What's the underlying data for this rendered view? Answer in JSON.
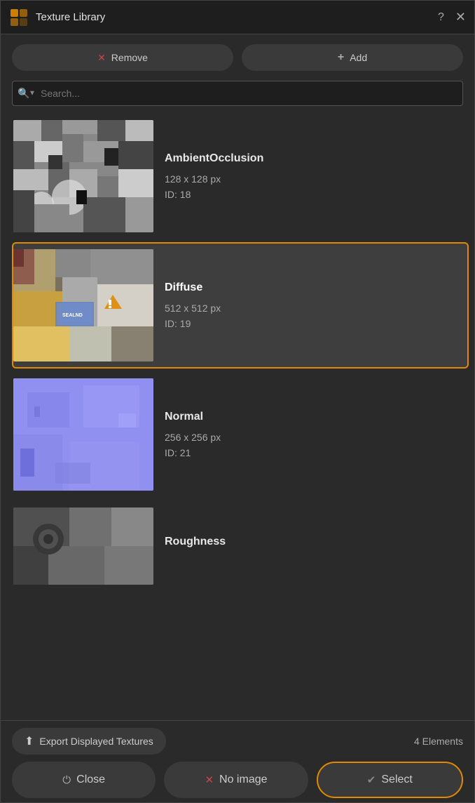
{
  "window": {
    "title": "Texture Library",
    "help_label": "?",
    "close_label": "✕"
  },
  "toolbar": {
    "remove_label": "Remove",
    "add_label": "Add"
  },
  "search": {
    "placeholder": "Search..."
  },
  "textures": [
    {
      "id": "ambient",
      "name": "AmbientOcclusion",
      "dimensions": "128 x 128 px",
      "texture_id": "ID: 18",
      "selected": false,
      "thumb_type": "ambient"
    },
    {
      "id": "diffuse",
      "name": "Diffuse",
      "dimensions": "512 x 512 px",
      "texture_id": "ID: 19",
      "selected": true,
      "thumb_type": "diffuse"
    },
    {
      "id": "normal",
      "name": "Normal",
      "dimensions": "256 x 256 px",
      "texture_id": "ID: 21",
      "selected": false,
      "thumb_type": "normal"
    },
    {
      "id": "roughness",
      "name": "Roughness",
      "dimensions": "",
      "texture_id": "",
      "selected": false,
      "thumb_type": "roughness"
    }
  ],
  "bottom": {
    "export_label": "Export Displayed Textures",
    "elements_count": "4 Elements",
    "close_label": "Close",
    "noimage_label": "No image",
    "select_label": "Select"
  },
  "colors": {
    "accent": "#e08a00",
    "bg_dark": "#1e1e1e",
    "bg_medium": "#2a2a2a",
    "bg_item": "#3e3e3e"
  }
}
